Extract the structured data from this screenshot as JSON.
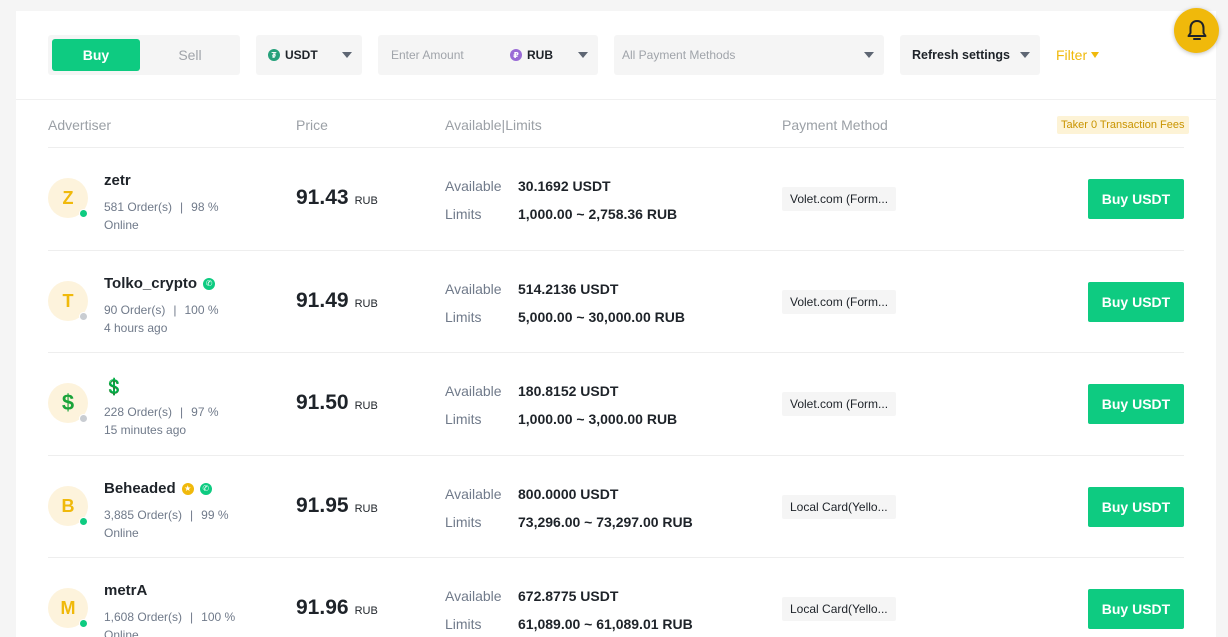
{
  "toolbar": {
    "buy_label": "Buy",
    "sell_label": "Sell",
    "asset": "USDT",
    "asset_icon": "tether-coin-icon",
    "amount_placeholder": "Enter Amount",
    "fiat": "RUB",
    "fiat_icon": "ruble-coin-icon",
    "payment_placeholder": "All Payment Methods",
    "refresh_label": "Refresh settings",
    "filter_label": "Filter",
    "notification_icon": "bell-icon"
  },
  "table_header": {
    "advertiser": "Advertiser",
    "price": "Price",
    "available_limits": "Available|Limits",
    "payment_method": "Payment Method",
    "fees_badge": "Taker 0 Transaction Fees"
  },
  "labels": {
    "available": "Available",
    "limits": "Limits",
    "price_unit": "RUB",
    "buy_button": "Buy USDT",
    "separator": "|"
  },
  "rows": [
    {
      "avatar": "Z",
      "name": "zetr",
      "orders": "581 Order(s)",
      "completion": "98 %",
      "status": "Online",
      "online": true,
      "price": "91.43",
      "available": "30.1692 USDT",
      "limits": "1,000.00 ~ 2,758.36 RUB",
      "payment": "Volet.com (Form...",
      "badges": []
    },
    {
      "avatar": "T",
      "name": "Tolko_crypto",
      "orders": "90 Order(s)",
      "completion": "100 %",
      "status": "4 hours ago",
      "online": false,
      "price": "91.49",
      "available": "514.2136 USDT",
      "limits": "5,000.00 ~ 30,000.00 RUB",
      "payment": "Volet.com (Form...",
      "badges": [
        "verified-phone-icon"
      ]
    },
    {
      "avatar": "$",
      "name": "💲",
      "orders": "228 Order(s)",
      "completion": "97 %",
      "status": "15 minutes ago",
      "online": false,
      "price": "91.50",
      "available": "180.8152 USDT",
      "limits": "1,000.00 ~ 3,000.00 RUB",
      "payment": "Volet.com (Form...",
      "badges": []
    },
    {
      "avatar": "B",
      "name": "Beheaded",
      "orders": "3,885 Order(s)",
      "completion": "99 %",
      "status": "Online",
      "online": true,
      "price": "91.95",
      "available": "800.0000 USDT",
      "limits": "73,296.00 ~ 73,297.00 RUB",
      "payment": "Local Card(Yello...",
      "badges": [
        "merchant-badge-icon",
        "verified-phone-icon"
      ]
    },
    {
      "avatar": "M",
      "name": "metrA",
      "orders": "1,608 Order(s)",
      "completion": "100 %",
      "status": "Online",
      "online": true,
      "price": "91.96",
      "available": "672.8775 USDT",
      "limits": "61,089.00 ~ 61,089.01 RUB",
      "payment": "Local Card(Yello...",
      "badges": []
    }
  ],
  "colors": {
    "green": "#0ecb81",
    "yellow": "#f0b90b",
    "offline_dot": "#c9cdd2"
  }
}
